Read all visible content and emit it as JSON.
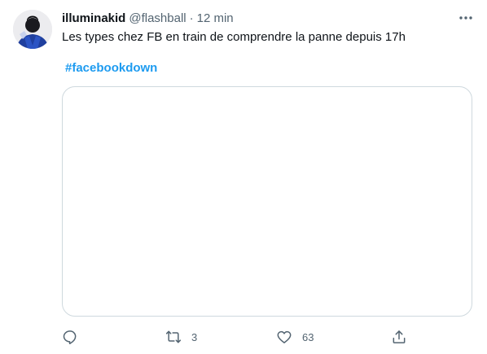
{
  "tweet": {
    "author": {
      "display_name": "illuminakid",
      "handle": "@flashball",
      "separator": "·",
      "time": "12 min"
    },
    "text": "Les types chez FB en train de comprendre la panne depuis 17h",
    "hashtag": "#facebookdown",
    "actions": {
      "reply": {
        "icon": "reply-icon",
        "count": ""
      },
      "retweet": {
        "icon": "retweet-icon",
        "count": "3"
      },
      "like": {
        "icon": "heart-icon",
        "count": "63"
      },
      "share": {
        "icon": "share-icon",
        "count": ""
      }
    }
  },
  "colors": {
    "text": "#0f1419",
    "secondary": "#536471",
    "accent": "#1d9bf0",
    "border": "#cfd9de"
  }
}
